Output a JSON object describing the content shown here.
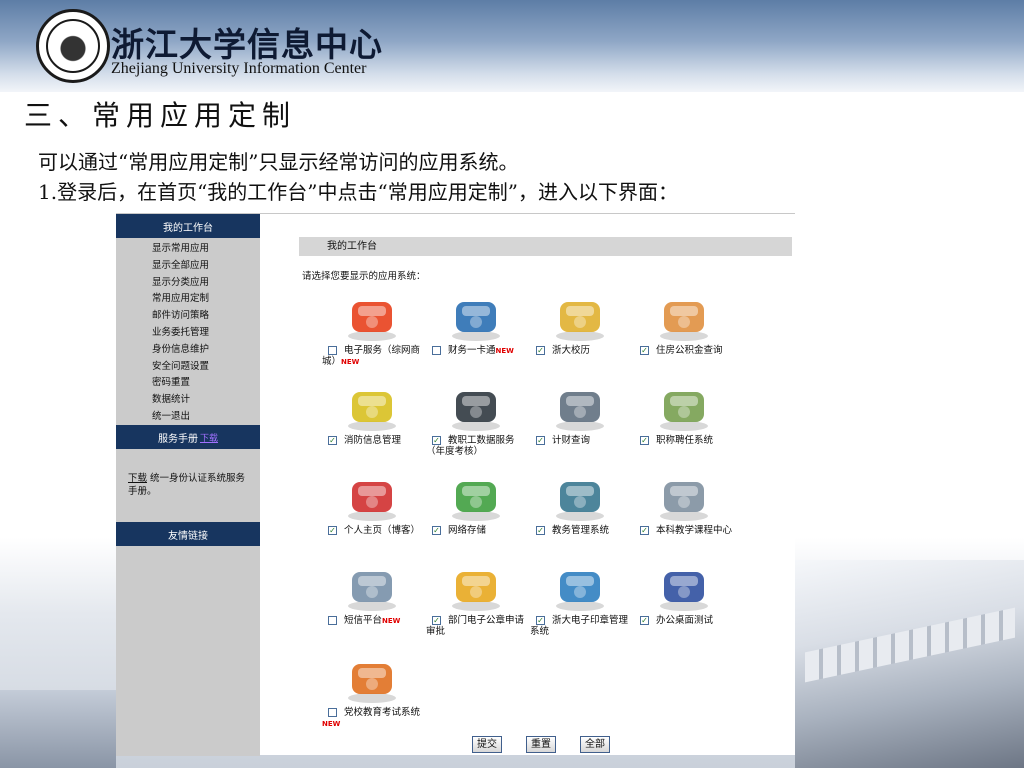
{
  "header": {
    "title_cn": "浙江大学信息中心",
    "title_en": "Zhejiang University Information Center"
  },
  "slide": {
    "section_title": "三、常用应用定制",
    "line1": "可以通过“常用应用定制”只显示经常访问的应用系统。",
    "line2": "1.登录后，在首页“我的工作台”中点击“常用应用定制”，进入以下界面："
  },
  "sidebar": {
    "head": "我的工作台",
    "items": [
      "显示常用应用",
      "显示全部应用",
      "显示分类应用",
      "常用应用定制",
      "邮件访问策略",
      "业务委托管理",
      "身份信息维护",
      "安全问题设置",
      "密码重置",
      "数据统计",
      "统一退出"
    ],
    "manual_head": "服务手册",
    "manual_link": "下载",
    "note_link": "下载",
    "note_text": " 统一身份认证系统服务手册。",
    "links_head": "友情链接"
  },
  "main": {
    "bar_title": "我的工作台",
    "prompt": "请选择您要显示的应用系统："
  },
  "apps": [
    {
      "label": "电子服务（综网商城）",
      "checked": false,
      "new": true,
      "icon": "red-circle-icon",
      "color": "#e8401c"
    },
    {
      "label": "财务一卡通",
      "checked": false,
      "new": true,
      "icon": "card-reader-icon",
      "color": "#2a6fb3"
    },
    {
      "label": "浙大校历",
      "checked": true,
      "new": false,
      "icon": "calendar-folder-icon",
      "color": "#e0b030"
    },
    {
      "label": "住房公积金查询",
      "checked": true,
      "new": false,
      "icon": "map-pin-icon",
      "color": "#e09040"
    },
    {
      "label": "消防信息管理",
      "checked": true,
      "new": false,
      "icon": "fire-map-icon",
      "color": "#d8c020"
    },
    {
      "label": "教职工数据服务（年度考核）",
      "checked": true,
      "new": false,
      "icon": "black-folder-icon",
      "color": "#303840"
    },
    {
      "label": "计财查询",
      "checked": true,
      "new": false,
      "icon": "office-machine-icon",
      "color": "#607080"
    },
    {
      "label": "职称聘任系统",
      "checked": true,
      "new": false,
      "icon": "compass-map-icon",
      "color": "#78a050"
    },
    {
      "label": "个人主页（博客）",
      "checked": true,
      "new": false,
      "icon": "flower-pot-icon",
      "color": "#d03030"
    },
    {
      "label": "网络存储",
      "checked": true,
      "new": false,
      "icon": "storage-check-icon",
      "color": "#40a040"
    },
    {
      "label": "教务管理系统",
      "checked": true,
      "new": false,
      "icon": "server-tower-icon",
      "color": "#3a7890"
    },
    {
      "label": "本科教学课程中心",
      "checked": true,
      "new": false,
      "icon": "network-graph-icon",
      "color": "#8090a0"
    },
    {
      "label": "短信平台",
      "checked": false,
      "new": true,
      "icon": "satellite-icon",
      "color": "#7890a8"
    },
    {
      "label": "部门电子公章申请审批",
      "checked": true,
      "new": false,
      "icon": "yellow-folder-icon",
      "color": "#e8a820"
    },
    {
      "label": "浙大电子印章管理系统",
      "checked": true,
      "new": false,
      "icon": "computer-icon",
      "color": "#3080c0"
    },
    {
      "label": "办公桌面测试",
      "checked": true,
      "new": false,
      "icon": "globe-icon",
      "color": "#3050a0"
    },
    {
      "label": "党校教育考试系统",
      "checked": false,
      "new": true,
      "icon": "book-pen-icon",
      "color": "#e07020"
    }
  ],
  "new_badge": "NEW",
  "buttons": {
    "submit": "提交",
    "reset": "重置",
    "all": "全部"
  }
}
